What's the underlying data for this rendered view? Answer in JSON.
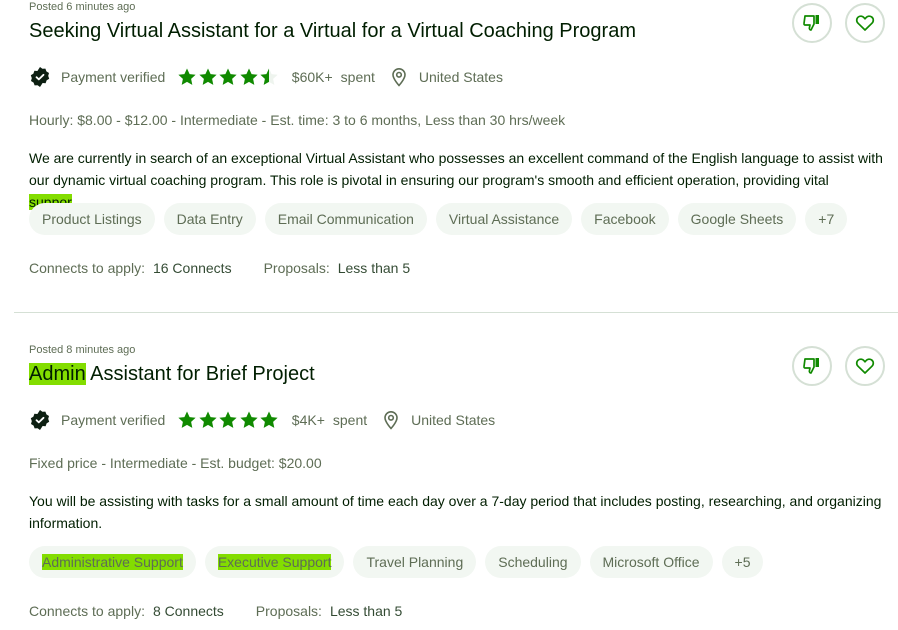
{
  "colors": {
    "brand_green": "#108a00",
    "highlight": "#83dd00",
    "pill_bg": "#f2f7f2",
    "muted_text": "#5e6d55",
    "dark_text": "#001e00"
  },
  "jobs": [
    {
      "posted": "Posted 6 minutes ago",
      "title_pre": "",
      "title_highlight": "",
      "title_rest": "Seeking Virtual Assistant for a Virtual for a Virtual Coaching Program",
      "payment_status": "Payment verified",
      "rating": 4.5,
      "rating_max": 5,
      "spent_amount": "$60K+",
      "spent_label": "spent",
      "location": "United States",
      "job_info": "Hourly: $8.00 - $12.00 - Intermediate - Est. time: 3 to 6 months, Less than 30 hrs/week",
      "description": "We are currently in search of an exceptional Virtual Assistant who possesses an excellent command of the English language to assist with our dynamic virtual coaching program. This role is pivotal in ensuring our program's smooth and efficient operation, providing vital ",
      "description_highlight": "suppor",
      "description_ellipsis": "…",
      "skills": [
        {
          "label": "Product Listings",
          "highlight": false
        },
        {
          "label": "Data Entry",
          "highlight": false
        },
        {
          "label": "Email Communication",
          "highlight": false
        },
        {
          "label": "Virtual Assistance",
          "highlight": false
        },
        {
          "label": "Facebook",
          "highlight": false
        },
        {
          "label": "Google Sheets",
          "highlight": false
        },
        {
          "label": "+7",
          "highlight": false
        }
      ],
      "connects_label": "Connects to apply:",
      "connects_value": "16 Connects",
      "proposals_label": "Proposals:",
      "proposals_value": "Less than 5",
      "icons": {
        "dislike": "thumbs-down-icon",
        "save": "heart-icon",
        "verified": "verified-badge-icon",
        "location": "map-pin-icon"
      }
    },
    {
      "posted": "Posted 8 minutes ago",
      "title_pre": "",
      "title_highlight": "Admin",
      "title_rest": " Assistant for Brief Project",
      "payment_status": "Payment verified",
      "rating": 5,
      "rating_max": 5,
      "spent_amount": "$4K+",
      "spent_label": "spent",
      "location": "United States",
      "job_info": "Fixed price - Intermediate - Est. budget: $20.00",
      "description": "You will be assisting with tasks for a small amount of time each day over a 7-day period that includes posting, researching, and organizing information.",
      "description_highlight": "",
      "description_ellipsis": "",
      "skills": [
        {
          "label": "Administrative Support",
          "highlight": true
        },
        {
          "label": "Executive Support",
          "highlight": true
        },
        {
          "label": "Travel Planning",
          "highlight": false
        },
        {
          "label": "Scheduling",
          "highlight": false
        },
        {
          "label": "Microsoft Office",
          "highlight": false
        },
        {
          "label": "+5",
          "highlight": false
        }
      ],
      "connects_label": "Connects to apply:",
      "connects_value": "8 Connects",
      "proposals_label": "Proposals:",
      "proposals_value": "Less than 5",
      "icons": {
        "dislike": "thumbs-down-icon",
        "save": "heart-icon",
        "verified": "verified-badge-icon",
        "location": "map-pin-icon"
      }
    }
  ]
}
